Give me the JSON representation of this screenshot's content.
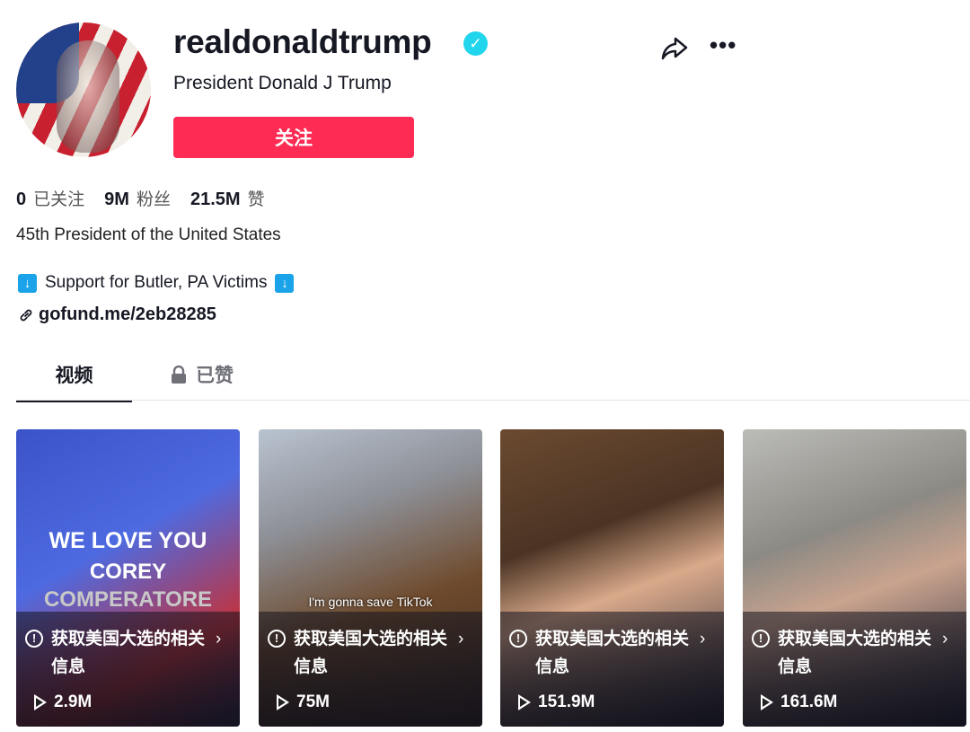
{
  "profile": {
    "username": "realdonaldtrump",
    "verified": true,
    "nickname": "President Donald J Trump",
    "follow_label": "关注"
  },
  "stats": [
    {
      "value": "0",
      "label": "已关注"
    },
    {
      "value": "9M",
      "label": "粉丝"
    },
    {
      "value": "21.5M",
      "label": "赞"
    }
  ],
  "bio": {
    "line1": "45th President of the United States",
    "line2": "Support for Butler, PA Victims",
    "link": "gofund.me/2eb28285"
  },
  "tabs": [
    {
      "label": "视频",
      "active": true
    },
    {
      "label": "已赞",
      "locked": true
    }
  ],
  "accent": "#fe2c55",
  "videos": [
    {
      "overlay1": "WE LOVE YOU",
      "overlay2": "COREY",
      "overlay3": "COMPERATORE",
      "info": "获取美国大选的相关信息",
      "views": "2.9M"
    },
    {
      "overlay1": "I'm gonna save TikTok",
      "info": "获取美国大选的相关信息",
      "views": "75M"
    },
    {
      "info": "获取美国大选的相关信息",
      "views": "151.9M"
    },
    {
      "info": "获取美国大选的相关信息",
      "views": "161.6M"
    }
  ]
}
